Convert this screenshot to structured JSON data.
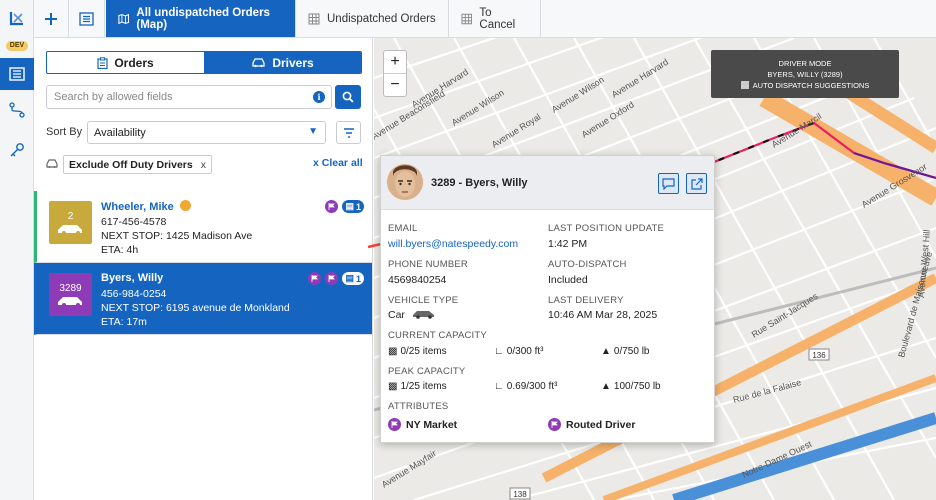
{
  "rail": {
    "env_badge": "DEV"
  },
  "topbar": {
    "tabs": [
      {
        "label": "All undispatched Orders (Map)",
        "icon": "map-icon",
        "active": true
      },
      {
        "label": "Undispatched Orders",
        "icon": "grid-icon",
        "active": false
      },
      {
        "label": "To Cancel",
        "icon": "grid-icon",
        "active": false
      }
    ]
  },
  "panel": {
    "segment": {
      "orders": "Orders",
      "drivers": "Drivers",
      "selected": "Drivers"
    },
    "search": {
      "placeholder": "Search by allowed fields"
    },
    "sort": {
      "label": "Sort By",
      "value": "Availability"
    },
    "filter_chip": "Exclude Off Duty Drivers",
    "chip_close": "x",
    "clear_all": "x Clear all",
    "drivers": [
      {
        "badge": "2",
        "name": "Wheeler, Mike",
        "phone": "617-456-4578",
        "next_stop": "NEXT STOP: 1425 Madison Ave",
        "eta": "ETA: 4h",
        "count": "1",
        "color": "#c8a93b"
      },
      {
        "badge": "3289",
        "name": "Byers, Willy",
        "phone": "456-984-0254",
        "next_stop": "NEXT STOP: 6195 avenue de Monkland",
        "eta": "ETA: 17m",
        "count": "1",
        "color": "#8e3bb8"
      }
    ]
  },
  "map": {
    "zoom_in": "+",
    "zoom_out": "−",
    "mode": {
      "title": "DRIVER MODE",
      "driver": "BYERS, WILLY (3289)",
      "checkbox_label": "AUTO DISPATCH SUGGESTIONS"
    },
    "street_labels": [
      "Avenue Harvard",
      "Avenue Wilson",
      "Avenue Oxford",
      "Avenue Beaconsfield",
      "Avenue Royal",
      "Avenue Marcil",
      "Avenue Grosvenor",
      "Rue Saint-Jacques",
      "Rue de la Falaise",
      "Avenue Mayfair",
      "Notre-Dame Ouest",
      "Boulevard de Maisonneuve",
      "Avenue West Hill",
      "Avenue Harvard",
      "Avenue Wilson"
    ],
    "route_shield_1": "136",
    "route_shield_2": "138"
  },
  "popup": {
    "title": "3289 - Byers, Willy",
    "email_label": "EMAIL",
    "email": "will.byers@natespeedy.com",
    "last_pos_label": "LAST POSITION UPDATE",
    "last_pos": "1:42 PM",
    "phone_label": "PHONE NUMBER",
    "phone": "4569840254",
    "auto_label": "AUTO-DISPATCH",
    "auto": "Included",
    "vehicle_label": "VEHICLE TYPE",
    "vehicle": "Car",
    "last_del_label": "LAST DELIVERY",
    "last_del": "10:46 AM Mar 28, 2025",
    "current_label": "CURRENT CAPACITY",
    "current": {
      "items": "0/25 items",
      "volume": "0/300 ft³",
      "weight": "0/750 lb"
    },
    "peak_label": "PEAK CAPACITY",
    "peak": {
      "items": "1/25 items",
      "volume": "0.69/300 ft³",
      "weight": "100/750 lb"
    },
    "attributes_label": "ATTRIBUTES",
    "attributes": [
      "NY Market",
      "Routed Driver"
    ]
  },
  "colors": {
    "primary": "#1565c0",
    "attribute": "#8e3bb8",
    "route": "#e91e63"
  }
}
